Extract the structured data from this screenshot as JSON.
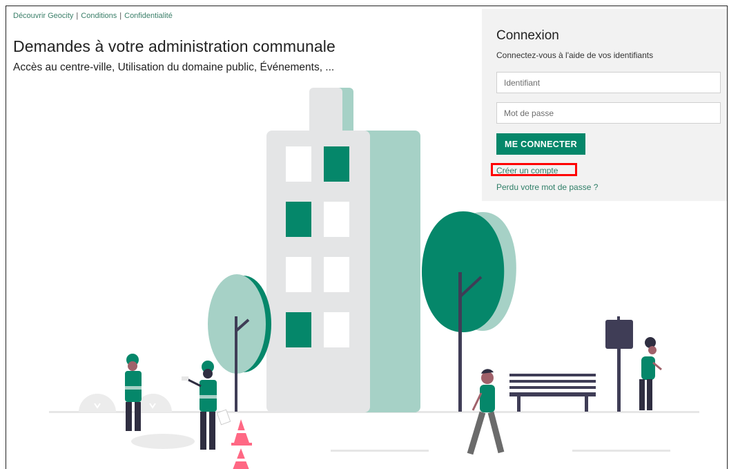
{
  "top_links": [
    {
      "label": "Découvrir Geocity"
    },
    {
      "label": "Conditions"
    },
    {
      "label": "Confidentialité"
    }
  ],
  "separator": "|",
  "page": {
    "title": "Demandes à votre administration communale",
    "subtitle": "Accès au centre-ville, Utilisation du domaine public, Événements, ..."
  },
  "login": {
    "title": "Connexion",
    "subtitle": "Connectez-vous à l'aide de vos identifiants",
    "username_placeholder": "Identifiant",
    "password_placeholder": "Mot de passe",
    "submit_label": "ME CONNECTER",
    "create_account_label": "Créer un compte",
    "forgot_password_label": "Perdu votre mot de passe ?"
  },
  "colors": {
    "brand_green": "#05876a",
    "light_green": "#a6d1c6",
    "highlight_red": "#ff0000",
    "panel_bg": "#f2f2f2"
  }
}
